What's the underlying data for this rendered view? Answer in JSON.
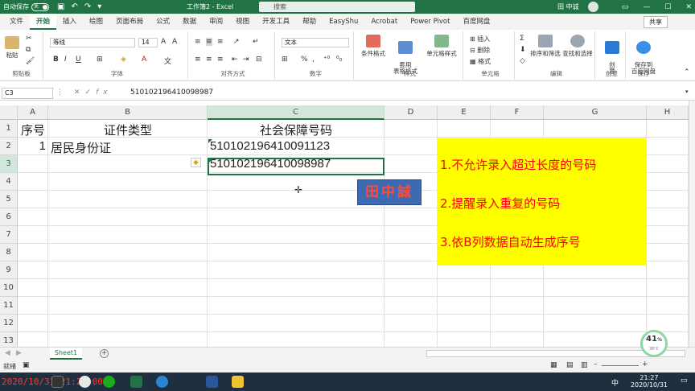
{
  "titlebar": {
    "autosave_label": "自动保存",
    "autosave_state": "关",
    "title": "工作簿2 - Excel",
    "search_placeholder": "搜索",
    "user": "田 中诚"
  },
  "menu": {
    "tabs": [
      "文件",
      "开始",
      "插入",
      "绘图",
      "页面布局",
      "公式",
      "数据",
      "审阅",
      "视图",
      "开发工具",
      "帮助",
      "EasyShu",
      "Acrobat",
      "Power Pivot",
      "百度网盘"
    ],
    "active": "开始",
    "share": "共享"
  },
  "ribbon": {
    "clipboard": {
      "paste": "粘贴",
      "label": "剪贴板"
    },
    "font": {
      "name": "等线",
      "size": "14",
      "label": "字体",
      "bold": "B",
      "italic": "I",
      "underline": "U"
    },
    "alignment": {
      "label": "对齐方式"
    },
    "number": {
      "format": "文本",
      "label": "数字"
    },
    "styles": {
      "cond": "条件格式",
      "table": "套用\n表格格式",
      "cell": "单元格样式",
      "label": "样式"
    },
    "cells": {
      "insert": "插入",
      "delete": "删除",
      "format": "格式",
      "label": "单元格"
    },
    "editing": {
      "sort": "排序和筛选",
      "find": "查找和选择",
      "label": "编辑"
    },
    "ideas": {
      "btn": "创\n意",
      "label": "创意"
    },
    "save": {
      "btn": "保存到\n百度网盘",
      "label": "保存"
    }
  },
  "formula_bar": {
    "name_box": "C3",
    "fx": "fx",
    "value": "510102196410098987"
  },
  "grid": {
    "columns": [
      "A",
      "B",
      "C",
      "D",
      "E",
      "F",
      "G",
      "H"
    ],
    "selected_column": "C",
    "rows": [
      "1",
      "2",
      "3",
      "4",
      "5",
      "6",
      "7",
      "8",
      "9",
      "10",
      "11",
      "12",
      "13"
    ],
    "selected_row": "3",
    "cells": {
      "A1": "序号",
      "B1": "证件类型",
      "C1": "社会保障号码",
      "A2": "1",
      "B2": "居民身份证",
      "C2": "510102196410091123",
      "C3": "510102196410098987"
    }
  },
  "note": [
    "1.不允许录入超过长度的号码",
    "2.提醒录入重复的号码",
    "3.依B列数据自动生成序号"
  ],
  "stamp": "田中誠",
  "sheets": {
    "tabs": [
      "Sheet1"
    ],
    "active": "Sheet1"
  },
  "status": {
    "mode": "就绪",
    "zoom_percent": "41",
    "zoom_unit": "%",
    "temp": "38°C"
  },
  "taskbar": {
    "timestamp": "2020/10/31  21:27:00",
    "time": "21:27",
    "date": "2020/10/31",
    "ime": "中"
  }
}
